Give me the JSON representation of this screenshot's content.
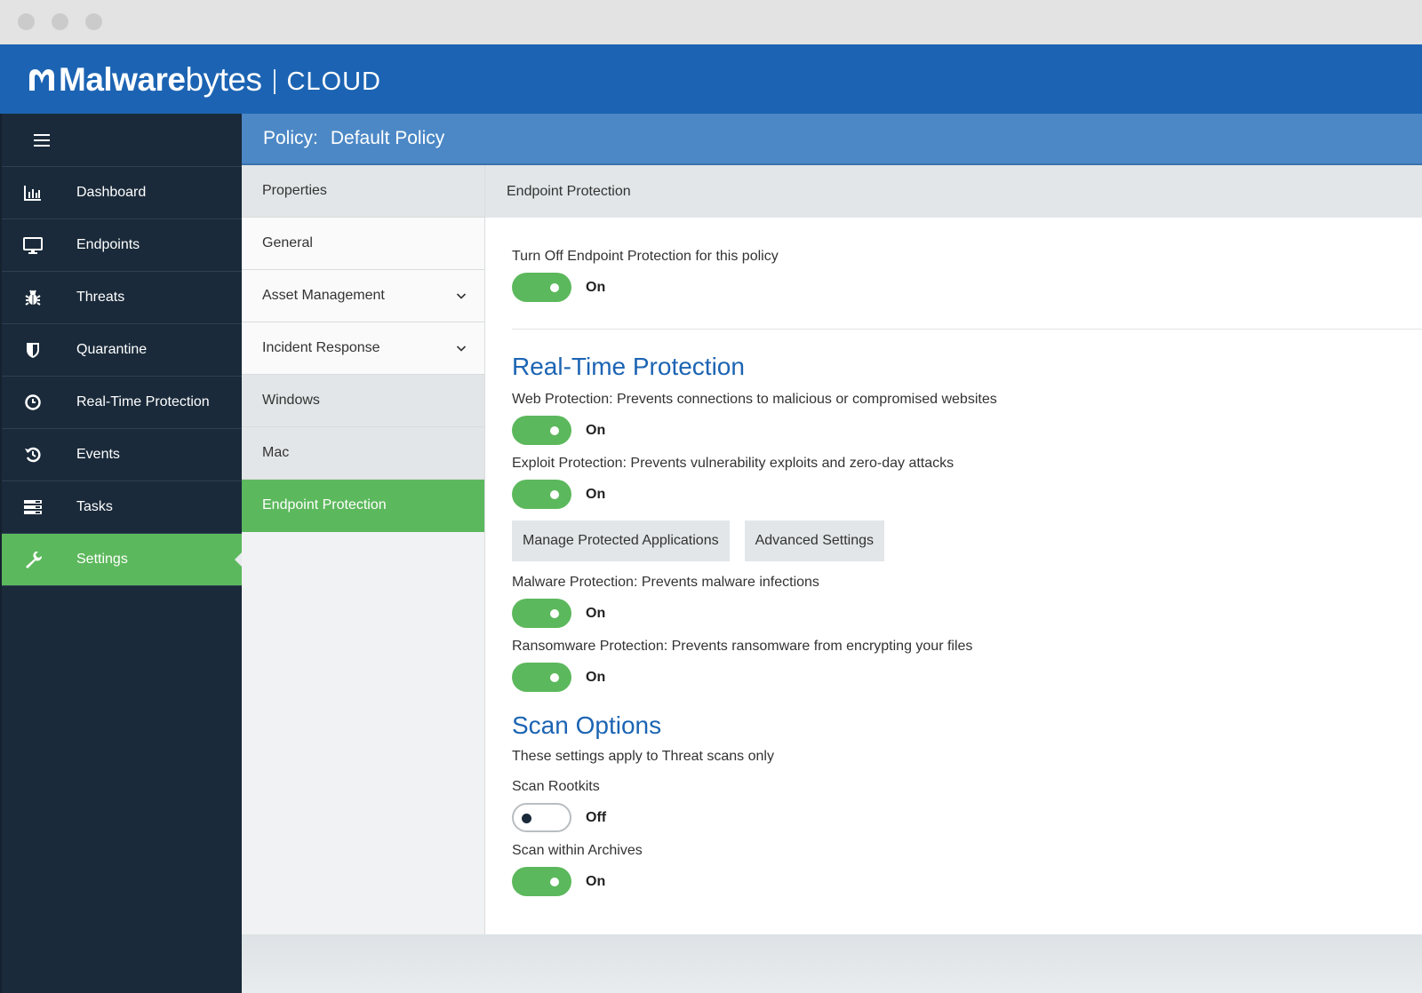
{
  "app": {
    "brand_bold": "Malware",
    "brand_light": "bytes",
    "product": "CLOUD"
  },
  "sidebar": {
    "items": [
      {
        "label": "Dashboard",
        "icon": "bar-chart-icon"
      },
      {
        "label": "Endpoints",
        "icon": "monitor-icon"
      },
      {
        "label": "Threats",
        "icon": "bug-icon"
      },
      {
        "label": "Quarantine",
        "icon": "shield-icon"
      },
      {
        "label": "Real-Time Protection",
        "icon": "clock-icon"
      },
      {
        "label": "Events",
        "icon": "history-icon"
      },
      {
        "label": "Tasks",
        "icon": "tasks-icon"
      },
      {
        "label": "Settings",
        "icon": "wrench-icon",
        "active": true
      }
    ]
  },
  "policy": {
    "label": "Policy:",
    "name": "Default Policy"
  },
  "subnav": {
    "header": "Properties",
    "items": [
      {
        "label": "General"
      },
      {
        "label": "Asset Management",
        "expandable": true
      },
      {
        "label": "Incident Response",
        "expandable": true
      },
      {
        "label": "Windows"
      },
      {
        "label": "Mac"
      },
      {
        "label": "Endpoint Protection",
        "active": true
      }
    ]
  },
  "content": {
    "header": "Endpoint Protection",
    "turn_off": {
      "label": "Turn Off Endpoint Protection for this policy",
      "state": "On"
    },
    "realtime": {
      "title": "Real-Time Protection",
      "web": {
        "label": "Web Protection: Prevents connections to malicious or compromised websites",
        "state": "On"
      },
      "exploit": {
        "label": "Exploit Protection: Prevents vulnerability exploits and zero-day attacks",
        "state": "On"
      },
      "buttons": {
        "manage": "Manage Protected Applications",
        "advanced": "Advanced Settings"
      },
      "malware": {
        "label": "Malware Protection: Prevents malware infections",
        "state": "On"
      },
      "ransomware": {
        "label": "Ransomware Protection: Prevents ransomware from encrypting your files",
        "state": "On"
      }
    },
    "scan": {
      "title": "Scan Options",
      "description": "These settings apply to Threat scans only",
      "rootkits": {
        "label": "Scan Rootkits",
        "state": "Off"
      },
      "archives": {
        "label": "Scan within Archives",
        "state": "On"
      }
    }
  },
  "colors": {
    "header_blue": "#1c64b3",
    "policy_blue": "#4c88c6",
    "sidebar_navy": "#1a2a3a",
    "active_green": "#5cb85c"
  }
}
